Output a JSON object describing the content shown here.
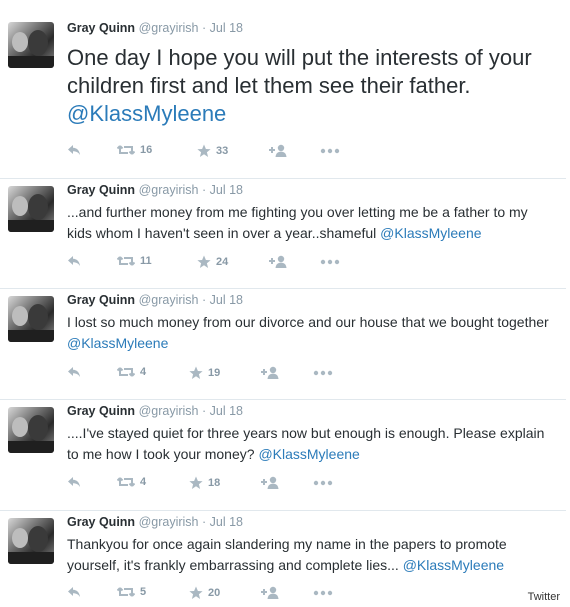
{
  "tweets": [
    {
      "name": "Gray Quinn",
      "handle": "@grayirish",
      "separator": "·",
      "date": "Jul 18",
      "text": "One day I hope you will put the interests of your children first and let them see their father.",
      "mention": "@KlassMyleene",
      "retweets": "16",
      "favorites": "33"
    },
    {
      "name": "Gray Quinn",
      "handle": "@grayirish",
      "separator": "·",
      "date": "Jul 18",
      "text": "...and further money from me fighting you over letting me be a father to my kids whom I haven't seen in over a year..shameful",
      "mention": "@KlassMyleene",
      "retweets": "11",
      "favorites": "24"
    },
    {
      "name": "Gray Quinn",
      "handle": "@grayirish",
      "separator": "·",
      "date": "Jul 18",
      "text": "I lost so much money from our divorce and our house that we bought together",
      "mention": "@KlassMyleene",
      "retweets": "4",
      "favorites": "19"
    },
    {
      "name": "Gray Quinn",
      "handle": "@grayirish",
      "separator": "·",
      "date": "Jul 18",
      "text": "....I've stayed quiet for three years now but enough is enough. Please explain to me how I took your money?",
      "mention": "@KlassMyleene",
      "retweets": "4",
      "favorites": "18"
    },
    {
      "name": "Gray Quinn",
      "handle": "@grayirish",
      "separator": "·",
      "date": "Jul 18",
      "text": "Thankyou for once again slandering my name in the papers to promote yourself, it's frankly embarrassing and complete lies...",
      "mention": "@KlassMyleene",
      "retweets": "5",
      "favorites": "20"
    }
  ],
  "icons": {
    "reply": "reply-icon",
    "retweet": "retweet-icon",
    "favorite": "star-icon",
    "follow": "follow-icon",
    "more": "more-icon"
  },
  "colors": {
    "mention": "#2b7bb9",
    "muted": "#8899a6",
    "text": "#292f33"
  },
  "credit": "Twitter"
}
